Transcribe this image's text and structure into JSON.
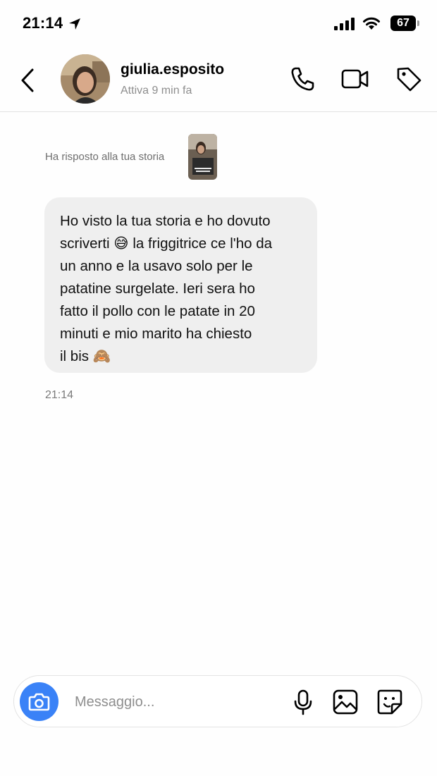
{
  "status_bar": {
    "time": "21:14",
    "battery": "67"
  },
  "header": {
    "username": "giulia.esposito",
    "activity": "Attiva 9 min fa"
  },
  "chat": {
    "story_reply_label": "Ha risposto alla tua storia",
    "message": {
      "lines": [
        "Ho visto la tua storia e ho dovuto",
        "scriverti 😅 la friggitrice ce l'ho da",
        "un anno e la usavo solo per le",
        "patatine surgelate. Ieri sera ho",
        "fatto il pollo con le patate in 20",
        "minuti e mio marito ha chiesto",
        "il bis 🙈"
      ],
      "time": "21:14"
    }
  },
  "composer": {
    "placeholder": "Messaggio..."
  },
  "colors": {
    "camera_button": "#3a82f7",
    "bubble": "#efefef"
  }
}
